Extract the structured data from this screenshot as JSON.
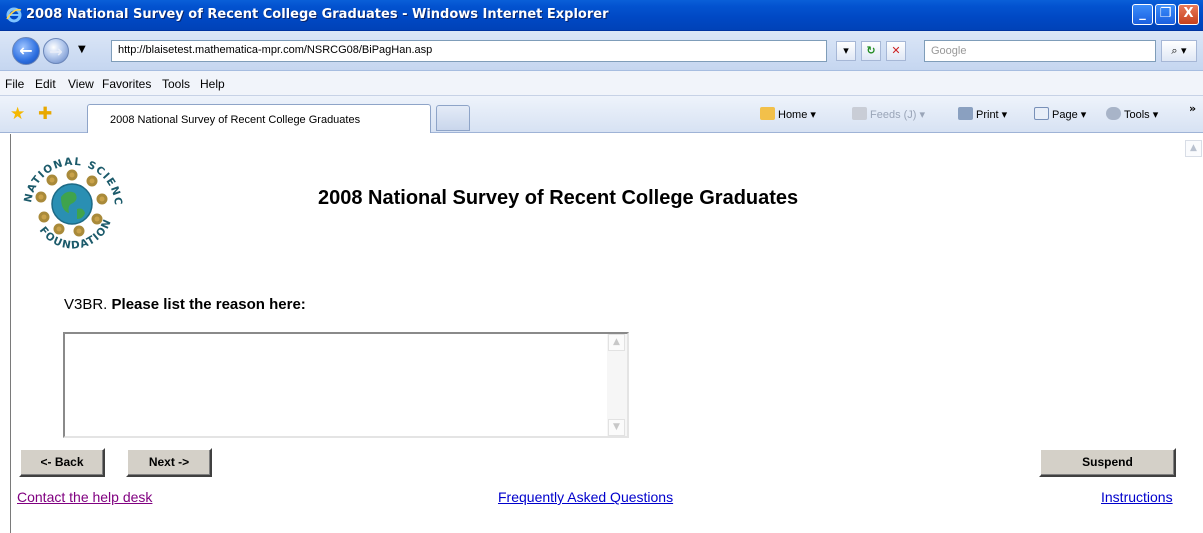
{
  "window": {
    "title": "2008 National Survey of Recent College Graduates - Windows Internet Explorer",
    "controls": {
      "minimize": "_",
      "maximize": "❐",
      "close": "X"
    }
  },
  "addressbar": {
    "url": "http://blaisetest.mathematica-mpr.com/NSRCG08/BiPagHan.asp",
    "search_placeholder": "Google"
  },
  "menu": [
    "File",
    "Edit",
    "View",
    "Favorites",
    "Tools",
    "Help"
  ],
  "tab": {
    "label": "2008 National Survey of Recent College Graduates"
  },
  "commandbar": {
    "home": "Home",
    "feeds": "Feeds (J)",
    "print": "Print",
    "page": "Page",
    "tools": "Tools"
  },
  "page": {
    "logo_text_top": "NATIONAL SCIENCE",
    "logo_text_bottom": "FOUNDATION",
    "survey_title": "2008 National Survey of Recent College Graduates",
    "question_id": "V3BR.",
    "question_text": "Please list the reason here:",
    "answer_value": ""
  },
  "buttons": {
    "back": "<- Back",
    "next": "Next ->",
    "suspend": "Suspend"
  },
  "links": {
    "help": "Contact the help desk",
    "faq": "Frequently Asked Questions",
    "instructions": "Instructions"
  },
  "colors": {
    "titlebar": "#0048c4",
    "visited_link": "#800080",
    "link": "#0000cc"
  }
}
